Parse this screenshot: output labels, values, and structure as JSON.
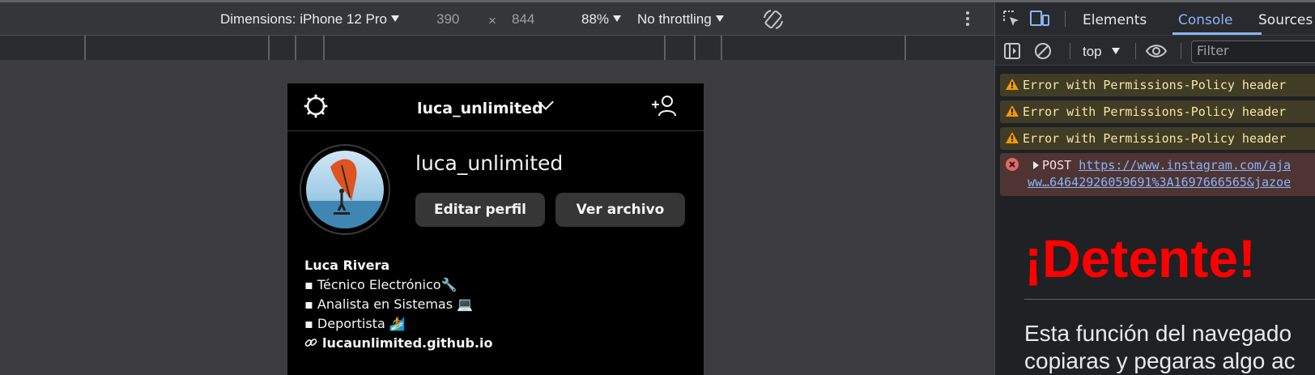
{
  "device_toolbar": {
    "dimensions_label": "Dimensions: iPhone 12 Pro",
    "width": "390",
    "times": "×",
    "height": "844",
    "zoom": "88%",
    "throttling": "No throttling"
  },
  "phone": {
    "header_username": "luca_unlimited",
    "profile_username": "luca_unlimited",
    "edit_profile": "Editar perfil",
    "view_archive": "Ver archivo",
    "bio": {
      "name": "Luca Rivera",
      "line1": "▪ Técnico Electrónico🔧",
      "line2": "▪ Analista en Sistemas 💻",
      "line3": "▪ Deportista 🏄",
      "link": "lucaunlimited.github.io"
    }
  },
  "devtools": {
    "tabs": [
      "Elements",
      "Console",
      "Sources"
    ],
    "active_tab": "Console",
    "context": "top",
    "filter_placeholder": "Filter",
    "warnings": [
      "Error with Permissions-Policy header",
      "Error with Permissions-Policy header",
      "Error with Permissions-Policy header"
    ],
    "error_method": "POST",
    "error_url": "https://www.instagram.com/aja",
    "error_url_cont": "ww…64642926059691%3A1697666565&jazoe",
    "stop_title": "¡Detente!",
    "stop_message_1": "Esta función del navegado",
    "stop_message_2": "copiaras y pegaras algo ac"
  },
  "colors": {
    "accent": "#8ab4f8",
    "warning_bg": "#413c26",
    "error_bg": "#4e3534",
    "stop_red": "#ff0000"
  },
  "icons": [
    "inspect-icon",
    "device-toggle-icon",
    "rotate-icon",
    "more-icon",
    "sidebar-icon",
    "clear-icon",
    "eye-icon",
    "warning-icon",
    "error-icon",
    "gear-icon",
    "add-user-icon",
    "link-icon"
  ]
}
